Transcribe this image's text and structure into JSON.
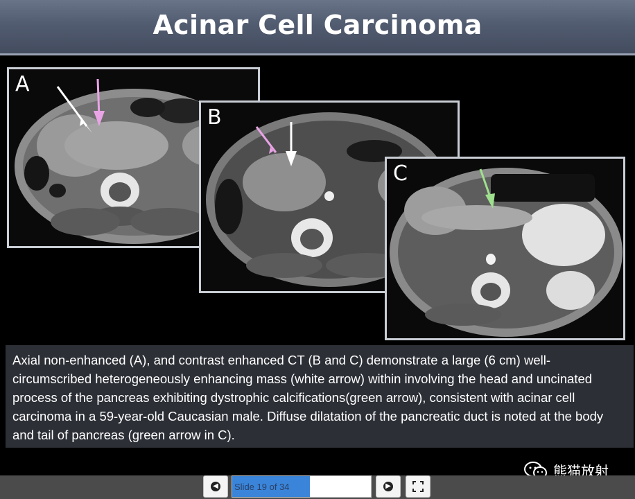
{
  "title": "Acinar Cell Carcinoma",
  "panels": [
    {
      "label": "A"
    },
    {
      "label": "B"
    },
    {
      "label": "C"
    }
  ],
  "caption": "Axial non-enhanced (A), and contrast enhanced CT (B and C) demonstrate a large (6 cm) well-circumscribed heterogeneously enhancing mass (white arrow) within involving the head and uncinated process of the pancreas exhibiting dystrophic calcifications(green arrow), consistent with acinar cell carcinoma in a 59-year-old Caucasian male. Diffuse dilatation of the pancreatic duct is noted at the body and tail of pancreas (green arrow in C).",
  "navigation": {
    "slide_text": "Slide 19 of 34",
    "current_slide": 19,
    "total_slides": 34,
    "prev_icon": "arrow-left-circle-icon",
    "next_icon": "arrow-right-circle-icon",
    "fullscreen_icon": "fullscreen-icon"
  },
  "watermark": {
    "text": "熊猫放射",
    "icon": "wechat-icon"
  },
  "colors": {
    "title_bg": "#525c70",
    "caption_bg": "#2c2f36",
    "arrow_white": "#ffffff",
    "arrow_pink": "#e9a4e6",
    "arrow_green": "#9fe08e",
    "progress_fill": "#3a85d9"
  }
}
